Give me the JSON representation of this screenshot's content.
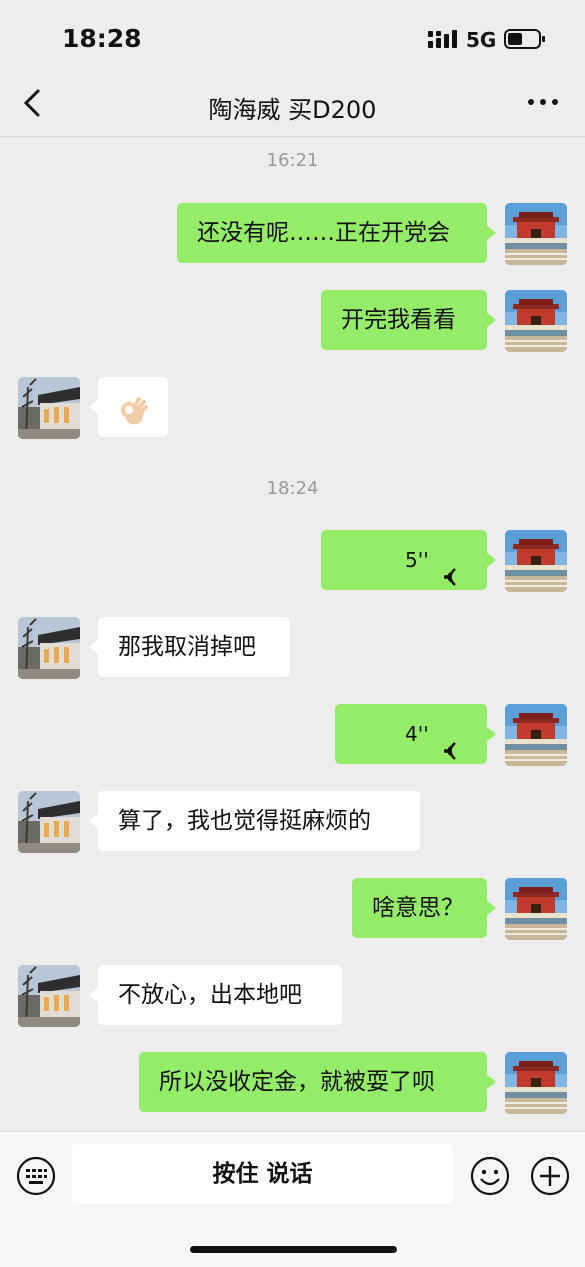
{
  "status_bar": {
    "time": "18:28",
    "network": "5G"
  },
  "header": {
    "title": "陶海威 买D200"
  },
  "messages": [
    {
      "type": "timestamp",
      "text": "16:21"
    },
    {
      "type": "text",
      "from": "me",
      "text": "还没有呢……正在开党会"
    },
    {
      "type": "text",
      "from": "me",
      "text": "开完我看看"
    },
    {
      "type": "emoji",
      "from": "them",
      "icon": "ok-hand-emoji"
    },
    {
      "type": "timestamp",
      "text": "18:24"
    },
    {
      "type": "voice",
      "from": "me",
      "duration": "5''"
    },
    {
      "type": "text",
      "from": "them",
      "text": "那我取消掉吧"
    },
    {
      "type": "voice",
      "from": "me",
      "duration": "4''"
    },
    {
      "type": "text",
      "from": "them",
      "text": "算了，我也觉得挺麻烦的"
    },
    {
      "type": "text",
      "from": "me",
      "text": "啥意思？"
    },
    {
      "type": "text",
      "from": "them",
      "text": "不放心，出本地吧"
    },
    {
      "type": "text",
      "from": "me",
      "text": "所以没收定金，就被耍了呗"
    }
  ],
  "input_bar": {
    "hold_to_talk_label": "按住 说话"
  },
  "colors": {
    "my_bubble": "#95ec69",
    "their_bubble": "#ffffff",
    "background": "#ededed"
  }
}
